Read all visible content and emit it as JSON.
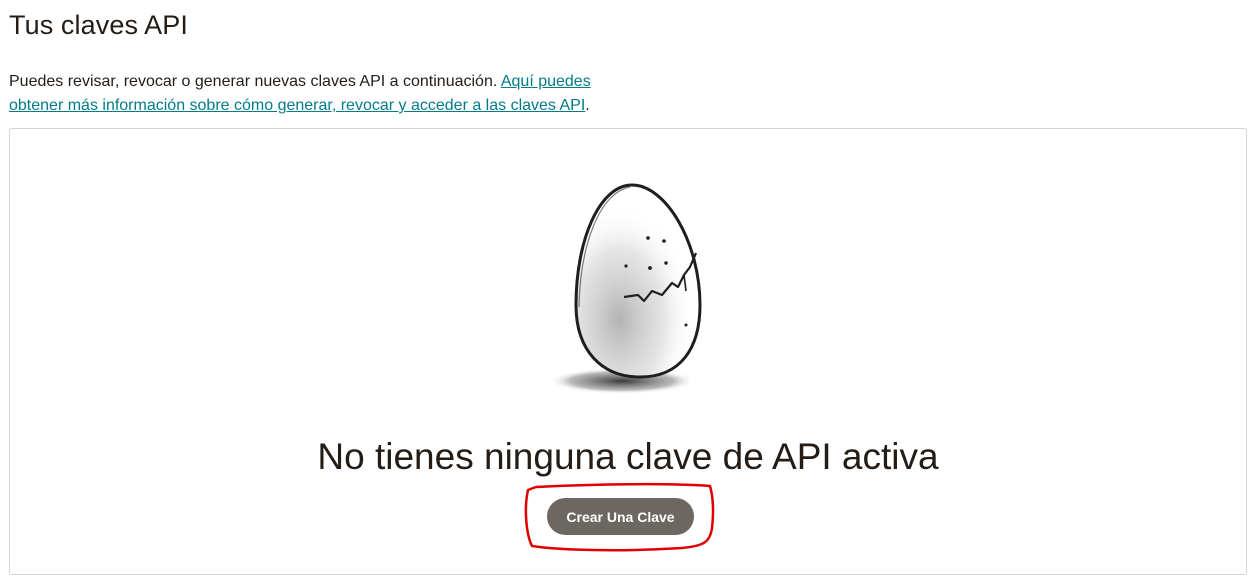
{
  "page": {
    "title": "Tus claves API",
    "intro_text": "Puedes revisar, revocar o generar nuevas claves API a continuación. ",
    "intro_link": "Aquí puedes obtener más información sobre cómo generar, revocar y acceder a las claves API",
    "intro_end": "."
  },
  "empty_state": {
    "illustration": "cracked-egg-icon",
    "heading": "No tienes ninguna clave de API activa",
    "button_label": "Crear Una Clave"
  },
  "colors": {
    "link": "#007c89",
    "button_bg": "#6d6762",
    "annotation": "#e00000"
  }
}
